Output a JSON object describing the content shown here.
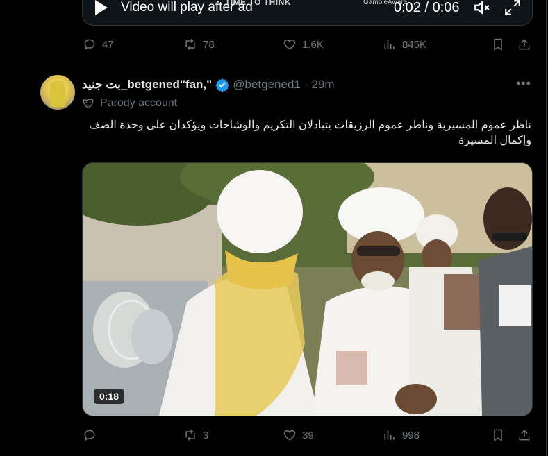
{
  "prev_tweet": {
    "player": {
      "message": "Video will play after ad",
      "ghost_text": "TIME TO THINK",
      "brand": "GambleAware",
      "time": "0:02 / 0:06"
    },
    "stats": {
      "replies": "47",
      "reposts": "78",
      "likes": "1.6K",
      "views": "845K"
    }
  },
  "tweet": {
    "display_name": "بت جنيد_betgened\"fan,\"",
    "handle": "@betgened1",
    "separator": "·",
    "time_ago": "29m",
    "label": "Parody account",
    "text": "ناظر عموم المسيرية وناظر عموم الرزيقات يتبادلان التكريم والوشاحات ويؤكدان على وحدة الصف وإكمال المسيرة",
    "video_duration": "0:18",
    "stats": {
      "replies": "",
      "reposts": "3",
      "likes": "39",
      "views": "998"
    }
  },
  "colors": {
    "background": "#000000",
    "text": "#e7e9ea",
    "muted": "#71767b",
    "verified": "#1d9bf0",
    "border": "#2f3336"
  },
  "icons": [
    "play-icon",
    "volume-muted-icon",
    "fullscreen-icon",
    "reply-icon",
    "repost-icon",
    "like-icon",
    "views-icon",
    "bookmark-icon",
    "share-icon",
    "verified-icon",
    "parody-mask-icon",
    "more-icon"
  ]
}
